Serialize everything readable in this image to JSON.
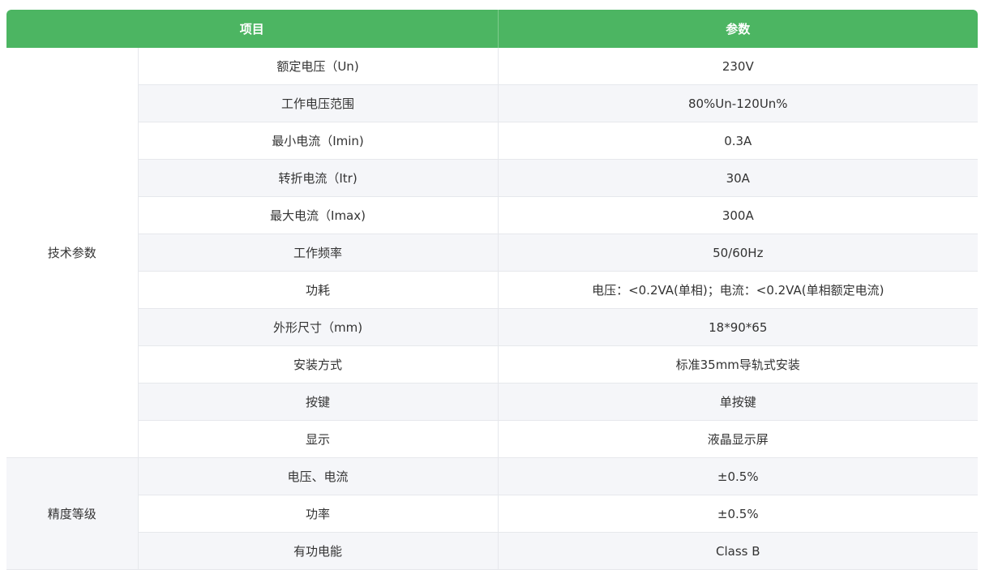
{
  "table": {
    "headers": {
      "item": "项目",
      "param": "参数"
    },
    "groups": [
      {
        "name": "技术参数",
        "rows": [
          {
            "item": "额定电压（Un)",
            "value": "230V"
          },
          {
            "item": "工作电压范围",
            "value": "80%Un-120Un%"
          },
          {
            "item": "最小电流（Imin)",
            "value": "0.3A"
          },
          {
            "item": "转折电流（Itr)",
            "value": "30A"
          },
          {
            "item": "最大电流（Imax)",
            "value": "300A"
          },
          {
            "item": "工作频率",
            "value": "50/60Hz"
          },
          {
            "item": "功耗",
            "value": "电压：<0.2VA(单相)；电流：<0.2VA(单相额定电流)"
          },
          {
            "item": "外形尺寸（mm)",
            "value": "18*90*65"
          },
          {
            "item": "安装方式",
            "value": "标准35mm导轨式安装"
          },
          {
            "item": "按键",
            "value": "单按键"
          },
          {
            "item": "显示",
            "value": "液晶显示屏"
          }
        ]
      },
      {
        "name": "精度等级",
        "rows": [
          {
            "item": "电压、电流",
            "value": "±0.5%"
          },
          {
            "item": "功率",
            "value": "±0.5%"
          },
          {
            "item": "有功电能",
            "value": "Class B"
          }
        ]
      }
    ]
  },
  "colors": {
    "header_bg": "#4cb562",
    "header_text": "#ffffff",
    "stripe": "#f5f6f9",
    "border": "#e6e8ec"
  }
}
